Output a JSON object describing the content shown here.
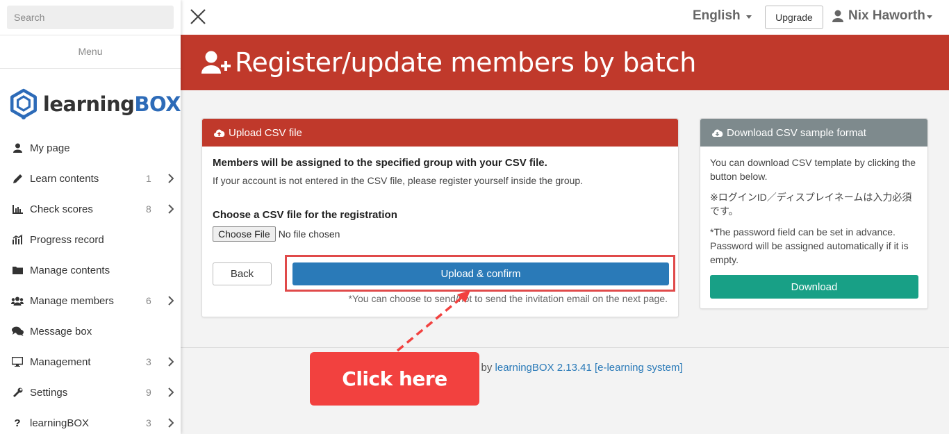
{
  "sidebar": {
    "search_placeholder": "Search",
    "menu_label": "Menu",
    "logo": {
      "learning": "learning",
      "box": "BOX"
    },
    "items": [
      {
        "label": "My page",
        "count": "",
        "icon": "user-icon",
        "has_chevron": false
      },
      {
        "label": "Learn contents",
        "count": "1",
        "icon": "pencil-icon",
        "has_chevron": true
      },
      {
        "label": "Check scores",
        "count": "8",
        "icon": "bar-chart-icon",
        "has_chevron": true
      },
      {
        "label": "Progress record",
        "count": "",
        "icon": "progress-chart-icon",
        "has_chevron": false
      },
      {
        "label": "Manage contents",
        "count": "",
        "icon": "folder-icon",
        "has_chevron": false
      },
      {
        "label": "Manage members",
        "count": "6",
        "icon": "users-icon",
        "has_chevron": true
      },
      {
        "label": "Message box",
        "count": "",
        "icon": "comments-icon",
        "has_chevron": false
      },
      {
        "label": "Management",
        "count": "3",
        "icon": "desktop-icon",
        "has_chevron": true
      },
      {
        "label": "Settings",
        "count": "9",
        "icon": "wrench-icon",
        "has_chevron": true
      },
      {
        "label": "learningBOX",
        "count": "3",
        "icon": "question-icon",
        "has_chevron": true
      }
    ]
  },
  "topbar": {
    "language": "English",
    "upgrade_label": "Upgrade",
    "user_name": "Nix Haworth"
  },
  "page": {
    "title": "Register/update members by batch"
  },
  "upload_panel": {
    "heading": "Upload CSV file",
    "bold_text": "Members will be assigned to the specified group with your CSV file.",
    "note_text": "If your account is not entered in the CSV file, please register yourself inside the group.",
    "choose_label": "Choose a CSV file for the registration",
    "file_button_label": "Choose File",
    "file_status": "No file chosen",
    "back_label": "Back",
    "confirm_label": "Upload & confirm",
    "invite_note": "*You can choose to send/not to send the invitation email on the next page."
  },
  "download_panel": {
    "heading": "Download CSV sample format",
    "line1": "You can download CSV template by clicking the button below.",
    "line2": "※ログインID／ディスプレイネームは入力必須です。",
    "line3": "*The password field can be set in advance. Password will be assigned automatically if it is empty.",
    "download_label": "Download"
  },
  "footer": {
    "prefix": "d by ",
    "link_text": "learningBOX 2.13.41 [e-learning system]"
  },
  "annotation": {
    "callout_text": "Click here"
  },
  "colors": {
    "brand_red": "#c0392b",
    "primary_blue": "#2a7ab8",
    "download_green": "#18a086",
    "panel_grey": "#7e8a8d",
    "callout_red": "#f2413f"
  }
}
